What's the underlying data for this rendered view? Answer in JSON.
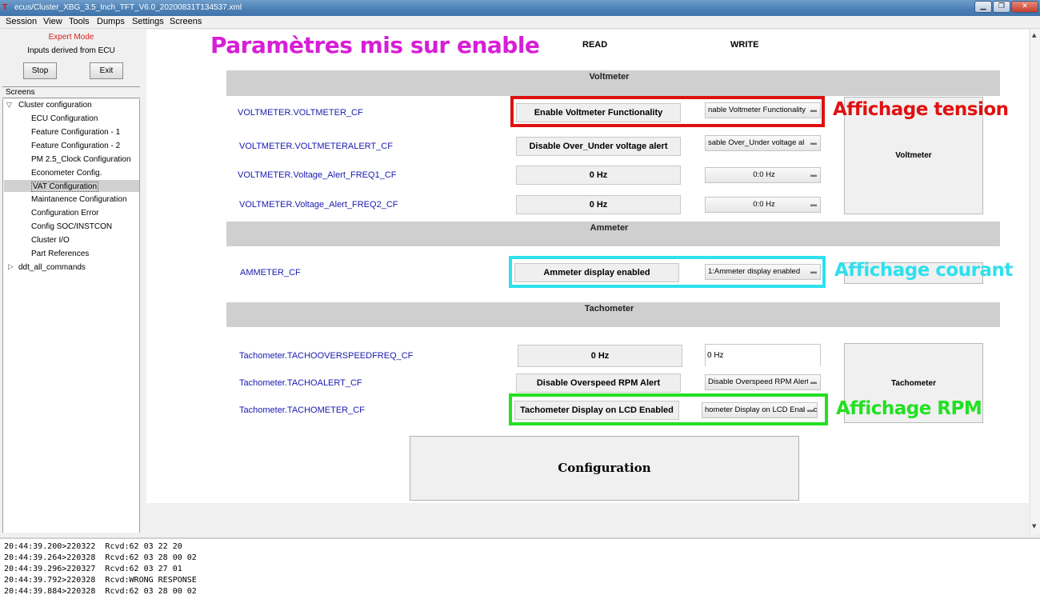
{
  "window": {
    "icon_text": "T",
    "title": "ecus/Cluster_XBG_3.5_Inch_TFT_V6.0_20200831T134537.xml",
    "min_label": "▁",
    "max_label": "❐",
    "close_label": "✕"
  },
  "menu": [
    "Session",
    "View",
    "Tools",
    "Dumps",
    "Settings",
    "Screens"
  ],
  "left_panel": {
    "mode": "Expert Mode",
    "inputs": "Inputs derived from ECU",
    "stop_label": "Stop",
    "exit_label": "Exit",
    "screens_header": "Screens"
  },
  "tree": {
    "root": "Cluster configuration",
    "children": [
      "ECU Configuration",
      "Feature Configuration - 1",
      "Feature Configuration - 2",
      "PM 2.5_Clock Configuration",
      "Econometer Config.",
      "VAT Configuration",
      "Maintanence Configuration",
      "Configuration Error",
      "Config SOC/INSTCON",
      "Cluster I/O",
      "Part References"
    ],
    "selected_index": 5,
    "other_root": "ddt_all_commands"
  },
  "headings": {
    "read": "READ",
    "write": "WRITE"
  },
  "sections": {
    "voltmeter": "Voltmeter",
    "ammeter": "Ammeter",
    "tachometer": "Tachometer"
  },
  "params": {
    "volt_cf": {
      "label": "VOLTMETER.VOLTMETER_CF",
      "read": "Enable Voltmeter Functionality",
      "write": "nable Voltmeter Functionality"
    },
    "volt_alert": {
      "label": "VOLTMETER.VOLTMETERALERT_CF",
      "read": "Disable Over_Under voltage alert",
      "write": "sable Over_Under voltage al"
    },
    "volt_freq1": {
      "label": "VOLTMETER.Voltage_Alert_FREQ1_CF",
      "read": "0 Hz",
      "write": "0:0 Hz"
    },
    "volt_freq2": {
      "label": "VOLTMETER.Voltage_Alert_FREQ2_CF",
      "read": "0 Hz",
      "write": "0:0 Hz"
    },
    "ammeter_cf": {
      "label": "AMMETER_CF",
      "read": "Ammeter display enabled",
      "write": "1:Ammeter display enabled"
    },
    "tacho_overspeed": {
      "label": "Tachometer.TACHOOVERSPEEDFREQ_CF",
      "read": "0 Hz",
      "write": "0 Hz"
    },
    "tacho_alert": {
      "label": "Tachometer.TACHOALERT_CF",
      "read": "Disable Overspeed RPM Alert",
      "write": "Disable Overspeed RPM Alert"
    },
    "tacho_cf": {
      "label": "Tachometer.TACHOMETER_CF",
      "read": "Tachometer Display on LCD Enabled",
      "write": "hometer Display on LCD Enablec"
    }
  },
  "side_buttons": {
    "voltmeter": "Voltmeter",
    "ammeter": "",
    "tachometer": "Tachometer"
  },
  "config_button": "Configuration",
  "annotations": {
    "title": "Paramètres mis sur enable",
    "tension": "Affichage tension",
    "courant": "Affichage courant",
    "rpm": "Affichage RPM",
    "colors": {
      "title": "#d61fd6",
      "tension": "#e01010",
      "courant": "#2ee0ee",
      "rpm": "#22e022"
    }
  },
  "log": [
    "20:44:39.200>220322  Rcvd:62 03 22 20",
    "20:44:39.264>220328  Rcvd:62 03 28 00 02",
    "20:44:39.296>220327  Rcvd:62 03 27 01",
    "20:44:39.792>220328  Rcvd:WRONG RESPONSE",
    "20:44:39.884>220328  Rcvd:62 03 28 00 02"
  ]
}
